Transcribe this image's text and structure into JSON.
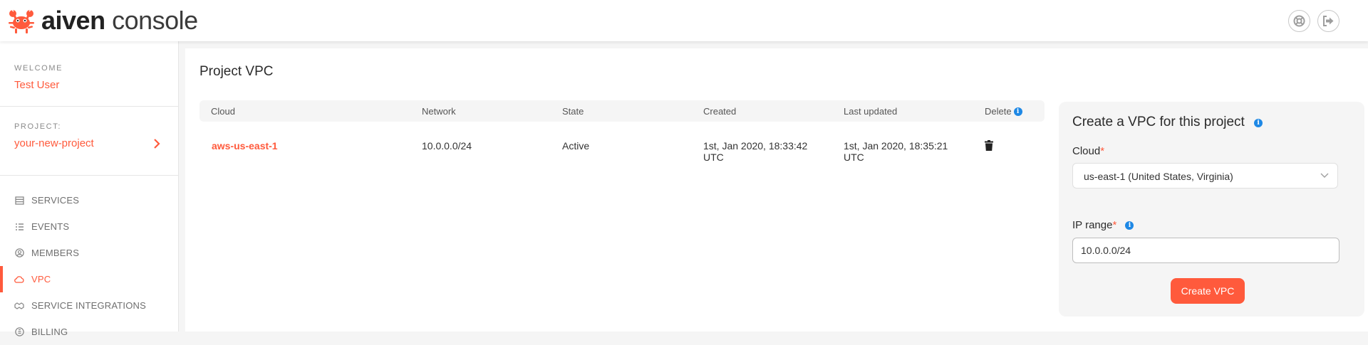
{
  "header": {
    "brand_bold": "aiven",
    "brand_rest": "console",
    "help_icon": "help-icon",
    "logout_icon": "logout-icon"
  },
  "sidebar": {
    "welcome_caption": "WELCOME",
    "user_name": "Test User",
    "project_caption": "PROJECT:",
    "project_name": "your-new-project",
    "items": [
      {
        "label": "SERVICES",
        "icon": "services-icon"
      },
      {
        "label": "EVENTS",
        "icon": "events-icon"
      },
      {
        "label": "MEMBERS",
        "icon": "members-icon"
      },
      {
        "label": "VPC",
        "icon": "cloud-icon",
        "active": true
      },
      {
        "label": "SERVICE INTEGRATIONS",
        "icon": "integrations-icon"
      },
      {
        "label": "BILLING",
        "icon": "billing-icon"
      }
    ]
  },
  "main": {
    "title": "Project VPC",
    "table": {
      "headers": [
        "Cloud",
        "Network",
        "State",
        "Created",
        "Last updated",
        "Delete"
      ],
      "rows": [
        {
          "cloud": "aws-us-east-1",
          "network": "10.0.0.0/24",
          "state": "Active",
          "created_1": "1st, Jan 2020, 18:33:42",
          "created_2": "UTC",
          "updated_1": "1st, Jan 2020, 18:35:21",
          "updated_2": "UTC"
        }
      ]
    }
  },
  "panel": {
    "title": "Create a VPC for this project",
    "cloud_label": "Cloud",
    "required_mark": "*",
    "cloud_value": "us-east-1 (United States, Virginia)",
    "ip_label": "IP range",
    "ip_value": "10.0.0.0/24",
    "submit_label": "Create VPC"
  },
  "colors": {
    "accent": "#ff5a3c",
    "info": "#1e88e5"
  }
}
